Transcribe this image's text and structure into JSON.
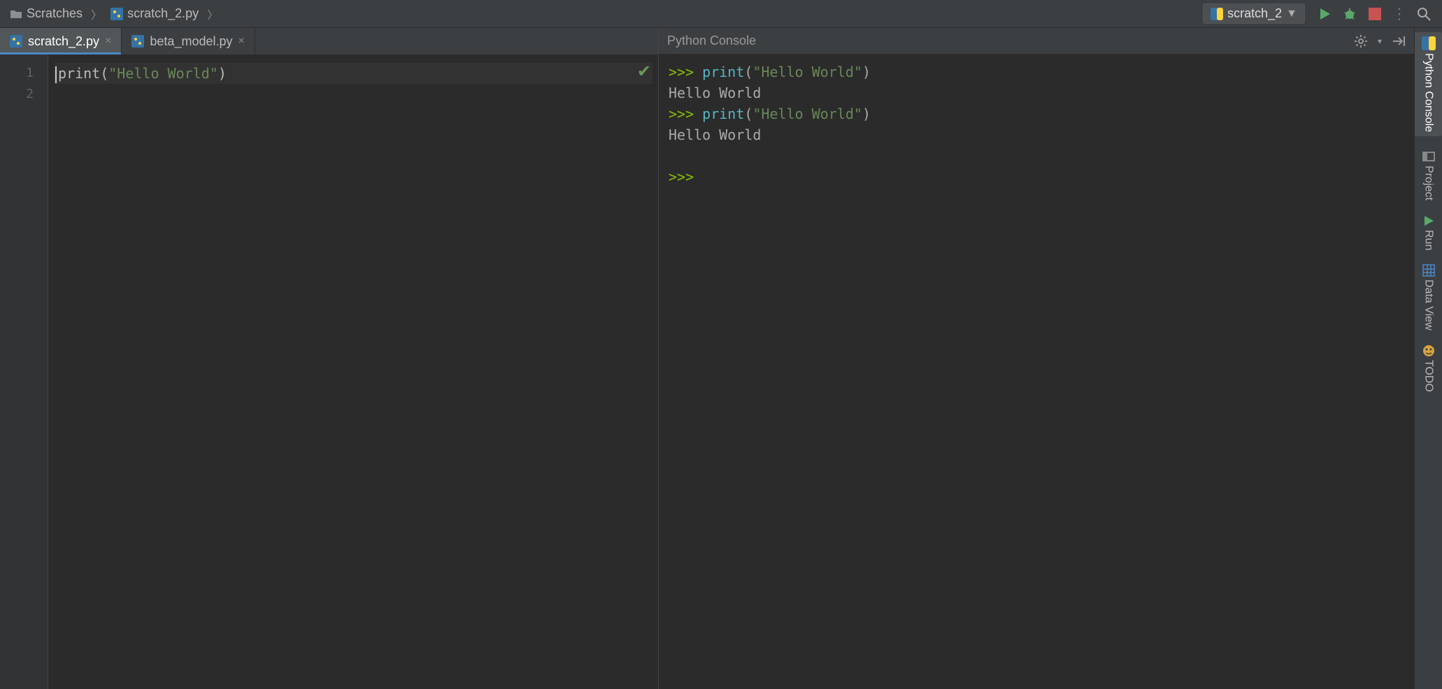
{
  "breadcrumbs": {
    "item0": "Scratches",
    "item1": "scratch_2.py"
  },
  "runconfig": {
    "label": "scratch_2"
  },
  "tabs": {
    "t0": "scratch_2.py",
    "t1": "beta_model.py"
  },
  "editor": {
    "gutter": {
      "l1": "1",
      "l2": "2"
    },
    "line1_fn": "print",
    "line1_lparen": "(",
    "line1_str": "\"Hello World\"",
    "line1_rparen": ")"
  },
  "console": {
    "title": "Python Console",
    "prompt": ">>>",
    "cmd1_fn": "print",
    "cmd1_lp": "(",
    "cmd1_str": "\"Hello World\"",
    "cmd1_rp": ")",
    "out1": "Hello World",
    "cmd2_fn": "print",
    "cmd2_lp": "(",
    "cmd2_str": "\"Hello World\"",
    "cmd2_rp": ")",
    "out2": "Hello World"
  },
  "rightStrip": {
    "pythonConsole": "Python Console",
    "project": "Project",
    "run": "Run",
    "dataView": "Data View",
    "todo": "TODO"
  }
}
